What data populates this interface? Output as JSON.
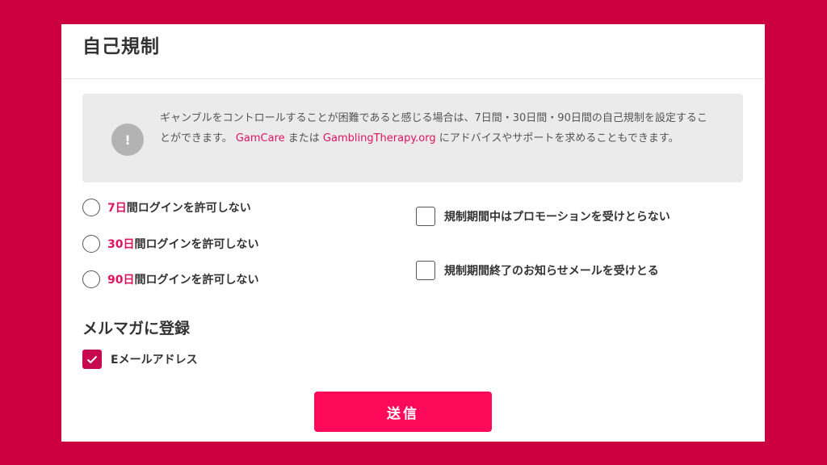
{
  "page": {
    "title": "自己規制"
  },
  "notice": {
    "icon": "!",
    "text_before": "ギャンブルをコントロールすることが困難であると感じる場合は、7日間・30日間・90日間の自己規制を設定することができます。 ",
    "link1": "GamCare",
    "text_middle": " または ",
    "link2": "GamblingTherapy.org",
    "text_after": " にアドバイスやサポートを求めることもできます。"
  },
  "self_exclusion": {
    "options": [
      {
        "highlight": "7日",
        "rest": "間ログインを許可しない",
        "checked": false
      },
      {
        "highlight": "30日",
        "rest": "間ログインを許可しない",
        "checked": false
      },
      {
        "highlight": "90日",
        "rest": "間ログインを許可しない",
        "checked": false
      }
    ],
    "checkboxes": [
      {
        "label": "規制期間中はプロモーションを受けとらない",
        "checked": false
      },
      {
        "label": "規制期間終了のお知らせメールを受けとる",
        "checked": false
      }
    ]
  },
  "newsletter": {
    "title": "メルマガに登録",
    "email_label": "Eメールアドレス",
    "email_checked": true
  },
  "submit_label": "送信",
  "colors": {
    "background": "#cc0040",
    "accent": "#e0135e",
    "button": "#ff0a5a",
    "checkbox_checked": "#c70a4e"
  }
}
